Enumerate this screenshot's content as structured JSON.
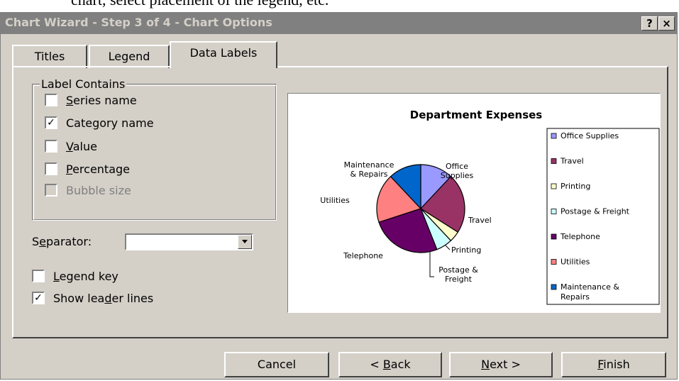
{
  "doc_fragment": "chart, select placement of the legend, etc.",
  "window": {
    "title": "Chart Wizard - Step 3 of 4 - Chart Options",
    "help_button": "?",
    "close_button": "×"
  },
  "tabs": [
    {
      "label": "Titles",
      "selected": false
    },
    {
      "label": "Legend",
      "selected": false
    },
    {
      "label": "Data Labels",
      "selected": true
    }
  ],
  "label_contains": {
    "group_label": "Label Contains",
    "options": [
      {
        "label": "Series name",
        "checked": false,
        "enabled": true
      },
      {
        "label": "Category name",
        "checked": true,
        "enabled": true
      },
      {
        "label": "Value",
        "checked": false,
        "enabled": true
      },
      {
        "label": "Percentage",
        "checked": false,
        "enabled": true
      },
      {
        "label": "Bubble size",
        "checked": false,
        "enabled": false
      }
    ]
  },
  "separator": {
    "label": "Separator:",
    "value": ""
  },
  "legend_key": {
    "label": "Legend key",
    "checked": false
  },
  "leader_lines": {
    "label": "Show leader lines",
    "checked": true
  },
  "chart_data": {
    "type": "pie",
    "title": "Department Expenses",
    "legend_position": "right",
    "slices": [
      {
        "name": "Office Supplies",
        "label": "Office Supplies",
        "value": 12,
        "color": "#9999ff"
      },
      {
        "name": "Travel",
        "label": "Travel",
        "value": 22,
        "color": "#993366"
      },
      {
        "name": "Printing",
        "label": "Printing",
        "value": 4,
        "color": "#ffffcc"
      },
      {
        "name": "Postage & Freight",
        "label": "Postage & Freight",
        "value": 6,
        "color": "#ccffff"
      },
      {
        "name": "Telephone",
        "label": "Telephone",
        "value": 26,
        "color": "#660066"
      },
      {
        "name": "Utilities",
        "label": "Utilities",
        "value": 18,
        "color": "#ff8080"
      },
      {
        "name": "Maintenance & Repairs",
        "label": "Maintenance & Repairs",
        "value": 12,
        "color": "#0066cc"
      }
    ]
  },
  "buttons": {
    "cancel": "Cancel",
    "back": "< Back",
    "next": "Next >",
    "finish": "Finish"
  }
}
